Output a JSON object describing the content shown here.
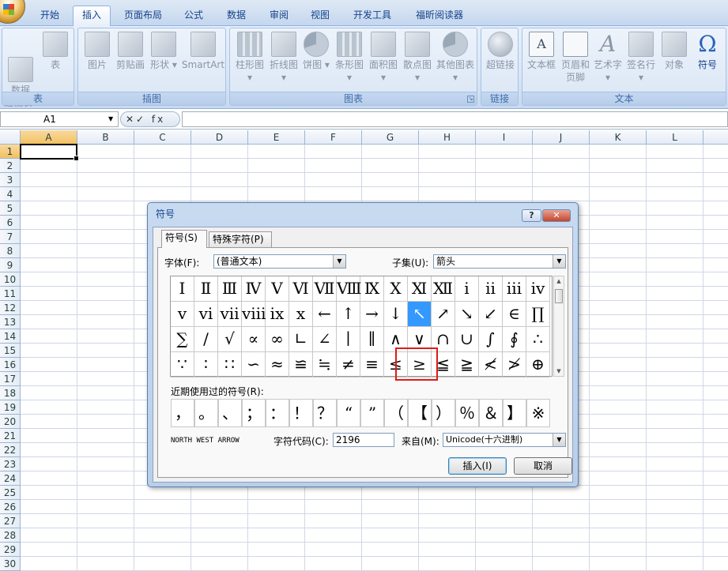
{
  "ribbon_tabs": [
    "开始",
    "插入",
    "页面布局",
    "公式",
    "数据",
    "审阅",
    "视图",
    "开发工具",
    "福昕阅读器"
  ],
  "active_tab": "插入",
  "groups": {
    "table": {
      "label": "表",
      "buttons": [
        "数据\n透视表 ▾",
        "表"
      ]
    },
    "illustrations": {
      "label": "插图",
      "buttons": [
        "图片",
        "剪贴画",
        "形状 ▾",
        "SmartArt"
      ]
    },
    "charts": {
      "label": "图表",
      "buttons": [
        "柱形图 ▾",
        "折线图 ▾",
        "饼图 ▾",
        "条形图 ▾",
        "面积图 ▾",
        "散点图 ▾",
        "其他图表 ▾"
      ]
    },
    "links": {
      "label": "链接",
      "buttons": [
        "超链接"
      ]
    },
    "text": {
      "label": "文本",
      "buttons": [
        "文本框",
        "页眉和\n页脚",
        "艺术字 ▾",
        "签名行 ▾",
        "对象",
        "符号"
      ]
    }
  },
  "formula_bar": {
    "name_box": "A1",
    "fx_label": "✕✓ fx",
    "value": ""
  },
  "columns": [
    "A",
    "B",
    "C",
    "D",
    "E",
    "F",
    "G",
    "H",
    "I",
    "J",
    "K",
    "L"
  ],
  "rows": [
    "1",
    "2",
    "3",
    "4",
    "5",
    "6",
    "7",
    "8",
    "9",
    "10",
    "11",
    "12",
    "13",
    "14",
    "15",
    "16",
    "17",
    "18",
    "19",
    "20",
    "21",
    "22",
    "23",
    "24",
    "25",
    "26",
    "27",
    "28",
    "29",
    "30"
  ],
  "dialog": {
    "title": "符号",
    "help": "?",
    "close": "✕",
    "tabs": [
      "符号(S)",
      "特殊字符(P)"
    ],
    "font_label": "字体(F):",
    "font_value": "(普通文本)",
    "subset_label": "子集(U):",
    "subset_value": "箭头",
    "symbols": [
      [
        "Ⅰ",
        "Ⅱ",
        "Ⅲ",
        "Ⅳ",
        "Ⅴ",
        "Ⅵ",
        "Ⅶ",
        "Ⅷ",
        "Ⅸ",
        "Ⅹ",
        "Ⅺ",
        "Ⅻ",
        "ⅰ",
        "ⅱ",
        "ⅲ",
        "ⅳ"
      ],
      [
        "ⅴ",
        "ⅵ",
        "ⅶ",
        "ⅷ",
        "ⅸ",
        "ⅹ",
        "←",
        "↑",
        "→",
        "↓",
        "↖",
        "↗",
        "↘",
        "↙",
        "∈",
        "∏"
      ],
      [
        "∑",
        "∕",
        "√",
        "∝",
        "∞",
        "∟",
        "∠",
        "∣",
        "∥",
        "∧",
        "∨",
        "∩",
        "∪",
        "∫",
        "∮",
        "∴"
      ],
      [
        "∵",
        "∶",
        "∷",
        "∽",
        "≈",
        "≌",
        "≒",
        "≠",
        "≡",
        "≤",
        "≥",
        "≦",
        "≧",
        "≮",
        "≯",
        "⊕"
      ]
    ],
    "selected_symbol": "↖",
    "recent_label": "近期使用过的符号(R):",
    "recent": [
      "，",
      "。",
      "、",
      "；",
      "：",
      "！",
      "？",
      "“",
      "”",
      "（",
      "【",
      "）",
      "％",
      "＆",
      "】",
      "※"
    ],
    "char_name": "NORTH WEST ARROW",
    "code_label": "字符代码(C):",
    "code_value": "2196",
    "from_label": "来自(M):",
    "from_value": "Unicode(十六进制)",
    "insert_button": "插入(I)",
    "cancel_button": "取消"
  }
}
